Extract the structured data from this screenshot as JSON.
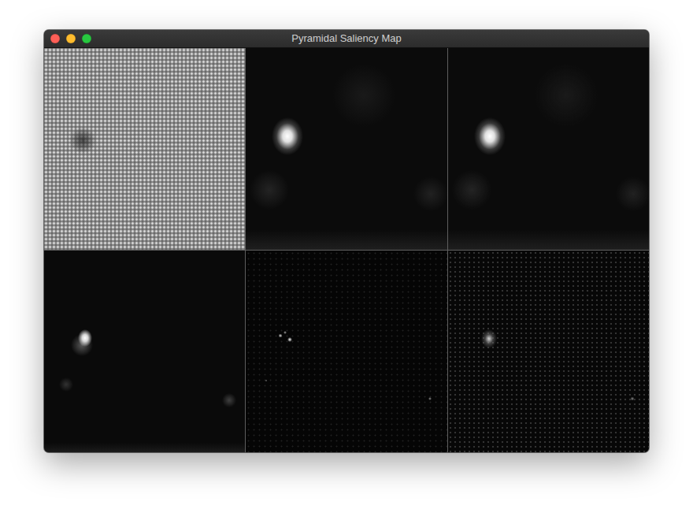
{
  "window": {
    "title": "Pyramidal Saliency Map"
  },
  "traffic_lights": [
    {
      "name": "close",
      "color": "#ff5f57"
    },
    {
      "name": "minimize",
      "color": "#febc2e"
    },
    {
      "name": "zoom",
      "color": "#28c840"
    }
  ],
  "panels": [
    {
      "kind": "input"
    },
    {
      "kind": "smooth"
    },
    {
      "kind": "smooth"
    },
    {
      "kind": "blocky"
    },
    {
      "kind": "sparse"
    },
    {
      "kind": "speckled"
    }
  ]
}
